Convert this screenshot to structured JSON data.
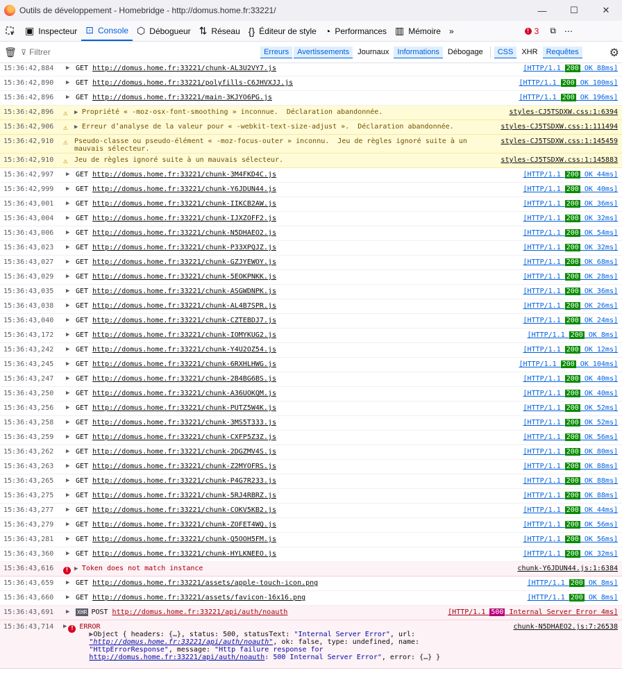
{
  "window": {
    "title": "Outils de développement - Homebridge - http://domus.home.fr:33221/",
    "minimize": "—",
    "maximize": "☐",
    "close": "✕"
  },
  "toolbar": {
    "picker_icon": "⬚",
    "tabs": [
      {
        "label": "Inspecteur",
        "icon": "inspector-icon"
      },
      {
        "label": "Console",
        "icon": "console-icon"
      },
      {
        "label": "Débogueur",
        "icon": "debugger-icon"
      },
      {
        "label": "Réseau",
        "icon": "network-icon"
      },
      {
        "label": "Éditeur de style",
        "icon": "style-editor-icon"
      },
      {
        "label": "Performances",
        "icon": "performance-icon"
      },
      {
        "label": "Mémoire",
        "icon": "memory-icon"
      }
    ],
    "error_count": "3"
  },
  "filterbar": {
    "placeholder": "Filtrer",
    "buttons": [
      "Erreurs",
      "Avertissements",
      "Journaux",
      "Informations",
      "Débogage"
    ],
    "extra": [
      "CSS",
      "XHR",
      "Requêtes"
    ]
  },
  "log": [
    {
      "type": "net",
      "ts": "15:36:42,884",
      "method": "GET",
      "url": "http://domus.home.fr:33221/chunk-AL3U2VY7.js",
      "proto": "[HTTP/1.1 ",
      "status": "200",
      "tail": " OK 88ms]"
    },
    {
      "type": "net",
      "ts": "15:36:42,890",
      "method": "GET",
      "url": "http://domus.home.fr:33221/polyfills-C6JHVXJJ.js",
      "proto": "[HTTP/1.1 ",
      "status": "200",
      "tail": " OK 100ms]"
    },
    {
      "type": "net",
      "ts": "15:36:42,896",
      "method": "GET",
      "url": "http://domus.home.fr:33221/main-3KJYO6PG.js",
      "proto": "[HTTP/1.1 ",
      "status": "200",
      "tail": " OK 196ms]"
    },
    {
      "type": "warn",
      "ts": "15:36:42,896",
      "arrow": true,
      "msg": "Propriété « -moz-osx-font-smoothing » inconnue.  Déclaration abandonnée.",
      "src": "styles-CJ5TSDXW.css:1:6394"
    },
    {
      "type": "warn",
      "ts": "15:36:42,906",
      "arrow": true,
      "msg": "Erreur d’analyse de la valeur pour « -webkit-text-size-adjust ».  Déclaration abandonnée.",
      "src": "styles-CJ5TSDXW.css:1:111494"
    },
    {
      "type": "warn",
      "ts": "15:36:42,910",
      "arrow": false,
      "msg": "Pseudo-classe ou pseudo-élément « -moz-focus-outer » inconnu.  Jeu de règles ignoré suite à un mauvais sélecteur.",
      "src": "styles-CJ5TSDXW.css:1:145459"
    },
    {
      "type": "warn",
      "ts": "15:36:42,910",
      "arrow": false,
      "msg": "Jeu de règles ignoré suite à un mauvais sélecteur.",
      "src": "styles-CJ5TSDXW.css:1:145883"
    },
    {
      "type": "net",
      "ts": "15:36:42,997",
      "method": "GET",
      "url": "http://domus.home.fr:33221/chunk-3M4FKD4C.js",
      "proto": "[HTTP/1.1 ",
      "status": "200",
      "tail": " OK 44ms]"
    },
    {
      "type": "net",
      "ts": "15:36:42,999",
      "method": "GET",
      "url": "http://domus.home.fr:33221/chunk-Y6JDUN44.js",
      "proto": "[HTTP/1.1 ",
      "status": "200",
      "tail": " OK 40ms]"
    },
    {
      "type": "net",
      "ts": "15:36:43,001",
      "method": "GET",
      "url": "http://domus.home.fr:33221/chunk-IIKCB2AW.js",
      "proto": "[HTTP/1.1 ",
      "status": "200",
      "tail": " OK 36ms]"
    },
    {
      "type": "net",
      "ts": "15:36:43,004",
      "method": "GET",
      "url": "http://domus.home.fr:33221/chunk-IJXZOFF2.js",
      "proto": "[HTTP/1.1 ",
      "status": "200",
      "tail": " OK 32ms]"
    },
    {
      "type": "net",
      "ts": "15:36:43,006",
      "method": "GET",
      "url": "http://domus.home.fr:33221/chunk-N5DHAEO2.js",
      "proto": "[HTTP/1.1 ",
      "status": "200",
      "tail": " OK 54ms]"
    },
    {
      "type": "net",
      "ts": "15:36:43,023",
      "method": "GET",
      "url": "http://domus.home.fr:33221/chunk-P33XPQJZ.js",
      "proto": "[HTTP/1.1 ",
      "status": "200",
      "tail": " OK 32ms]"
    },
    {
      "type": "net",
      "ts": "15:36:43,027",
      "method": "GET",
      "url": "http://domus.home.fr:33221/chunk-GZJYEWOY.js",
      "proto": "[HTTP/1.1 ",
      "status": "200",
      "tail": " OK 68ms]"
    },
    {
      "type": "net",
      "ts": "15:36:43,029",
      "method": "GET",
      "url": "http://domus.home.fr:33221/chunk-5EOKPNKK.js",
      "proto": "[HTTP/1.1 ",
      "status": "200",
      "tail": " OK 28ms]"
    },
    {
      "type": "net",
      "ts": "15:36:43,035",
      "method": "GET",
      "url": "http://domus.home.fr:33221/chunk-ASGWDNPK.js",
      "proto": "[HTTP/1.1 ",
      "status": "200",
      "tail": " OK 36ms]"
    },
    {
      "type": "net",
      "ts": "15:36:43,038",
      "method": "GET",
      "url": "http://domus.home.fr:33221/chunk-AL4B7SPR.js",
      "proto": "[HTTP/1.1 ",
      "status": "200",
      "tail": " OK 26ms]"
    },
    {
      "type": "net",
      "ts": "15:36:43,040",
      "method": "GET",
      "url": "http://domus.home.fr:33221/chunk-CZTEBDJ7.js",
      "proto": "[HTTP/1.1 ",
      "status": "200",
      "tail": " OK 24ms]"
    },
    {
      "type": "net",
      "ts": "15:36:43,172",
      "method": "GET",
      "url": "http://domus.home.fr:33221/chunk-IOMYKUG2.js",
      "proto": "[HTTP/1.1 ",
      "status": "200",
      "tail": " OK 8ms]"
    },
    {
      "type": "net",
      "ts": "15:36:43,242",
      "method": "GET",
      "url": "http://domus.home.fr:33221/chunk-Y4U2OZ54.js",
      "proto": "[HTTP/1.1 ",
      "status": "200",
      "tail": " OK 12ms]"
    },
    {
      "type": "net",
      "ts": "15:36:43,245",
      "method": "GET",
      "url": "http://domus.home.fr:33221/chunk-6RXHLHWG.js",
      "proto": "[HTTP/1.1 ",
      "status": "200",
      "tail": " OK 104ms]"
    },
    {
      "type": "net",
      "ts": "15:36:43,247",
      "method": "GET",
      "url": "http://domus.home.fr:33221/chunk-2B4BG6BS.js",
      "proto": "[HTTP/1.1 ",
      "status": "200",
      "tail": " OK 40ms]"
    },
    {
      "type": "net",
      "ts": "15:36:43,250",
      "method": "GET",
      "url": "http://domus.home.fr:33221/chunk-A36UOKQM.js",
      "proto": "[HTTP/1.1 ",
      "status": "200",
      "tail": " OK 40ms]"
    },
    {
      "type": "net",
      "ts": "15:36:43,256",
      "method": "GET",
      "url": "http://domus.home.fr:33221/chunk-PUTZ5W4K.js",
      "proto": "[HTTP/1.1 ",
      "status": "200",
      "tail": " OK 52ms]"
    },
    {
      "type": "net",
      "ts": "15:36:43,258",
      "method": "GET",
      "url": "http://domus.home.fr:33221/chunk-3MS5T333.js",
      "proto": "[HTTP/1.1 ",
      "status": "200",
      "tail": " OK 52ms]"
    },
    {
      "type": "net",
      "ts": "15:36:43,259",
      "method": "GET",
      "url": "http://domus.home.fr:33221/chunk-CXFP5Z3Z.js",
      "proto": "[HTTP/1.1 ",
      "status": "200",
      "tail": " OK 56ms]"
    },
    {
      "type": "net",
      "ts": "15:36:43,262",
      "method": "GET",
      "url": "http://domus.home.fr:33221/chunk-2DGZMV4S.js",
      "proto": "[HTTP/1.1 ",
      "status": "200",
      "tail": " OK 80ms]"
    },
    {
      "type": "net",
      "ts": "15:36:43,263",
      "method": "GET",
      "url": "http://domus.home.fr:33221/chunk-Z2MYOFRS.js",
      "proto": "[HTTP/1.1 ",
      "status": "200",
      "tail": " OK 88ms]"
    },
    {
      "type": "net",
      "ts": "15:36:43,265",
      "method": "GET",
      "url": "http://domus.home.fr:33221/chunk-P4G7R233.js",
      "proto": "[HTTP/1.1 ",
      "status": "200",
      "tail": " OK 88ms]"
    },
    {
      "type": "net",
      "ts": "15:36:43,275",
      "method": "GET",
      "url": "http://domus.home.fr:33221/chunk-5RJ4RBRZ.js",
      "proto": "[HTTP/1.1 ",
      "status": "200",
      "tail": " OK 88ms]"
    },
    {
      "type": "net",
      "ts": "15:36:43,277",
      "method": "GET",
      "url": "http://domus.home.fr:33221/chunk-COKV5KB2.js",
      "proto": "[HTTP/1.1 ",
      "status": "200",
      "tail": " OK 44ms]"
    },
    {
      "type": "net",
      "ts": "15:36:43,279",
      "method": "GET",
      "url": "http://domus.home.fr:33221/chunk-ZOFET4WQ.js",
      "proto": "[HTTP/1.1 ",
      "status": "200",
      "tail": " OK 56ms]"
    },
    {
      "type": "net",
      "ts": "15:36:43,281",
      "method": "GET",
      "url": "http://domus.home.fr:33221/chunk-Q5OOH5FM.js",
      "proto": "[HTTP/1.1 ",
      "status": "200",
      "tail": " OK 56ms]"
    },
    {
      "type": "net",
      "ts": "15:36:43,360",
      "method": "GET",
      "url": "http://domus.home.fr:33221/chunk-HYLKNEEO.js",
      "proto": "[HTTP/1.1 ",
      "status": "200",
      "tail": " OK 32ms]"
    },
    {
      "type": "error",
      "ts": "15:36:43,616",
      "arrow": true,
      "msg": "Token does not match instance",
      "src": "chunk-Y6JDUN44.js:1:6384"
    },
    {
      "type": "net",
      "ts": "15:36:43,659",
      "method": "GET",
      "url": "http://domus.home.fr:33221/assets/apple-touch-icon.png",
      "proto": "[HTTP/1.1 ",
      "status": "200",
      "tail": " OK 8ms]"
    },
    {
      "type": "net",
      "ts": "15:36:43,660",
      "method": "GET",
      "url": "http://domus.home.fr:33221/assets/favicon-16x16.png",
      "proto": "[HTTP/1.1 ",
      "status": "200",
      "tail": " OK 8ms]"
    },
    {
      "type": "xhr",
      "ts": "15:36:43,691",
      "badge": "XHR",
      "method": "POST",
      "url": "http://domus.home.fr:33221/api/auth/noauth",
      "proto": "[HTTP/1.1 ",
      "status": "500",
      "tail": " Internal Server Error 4ms]"
    }
  ],
  "last_error": {
    "ts": "15:36:43,714",
    "title": "ERROR",
    "src": "chunk-N5DHAEO2.js:7:26538",
    "obj_prefix": "Object { headers: {…}, status: 500, statusText: ",
    "status_text": "\"Internal Server Error\"",
    "url_label": ", url: ",
    "url_value": "\"http://domus.home.fr:33221/api/auth/noauth\"",
    "obj_mid": ", ok: false, type: undefined, name: ",
    "name_value": "\"HttpErrorResponse\"",
    "msg_label": ", message: ",
    "msg_start": "\"Http failure response for ",
    "msg_link": "http://domus.home.fr:33221/api/auth/noauth",
    "msg_end": ": 500 Internal Server Error\"",
    "obj_end": ", error: {…} }"
  }
}
